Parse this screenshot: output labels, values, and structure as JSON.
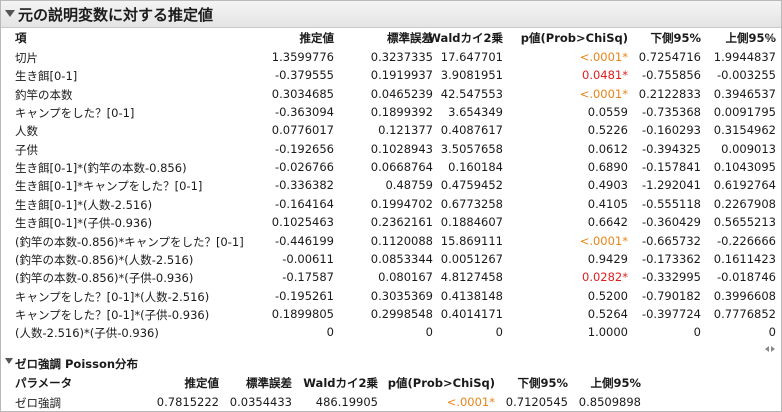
{
  "title": "元の説明変数に対する推定値",
  "table1": {
    "headers": [
      "項",
      "推定値",
      "標準誤差",
      "Waldカイ2乗",
      "p値(Prob>ChiSq)",
      "下側95%",
      "上側95%"
    ],
    "rows": [
      {
        "term": "切片",
        "est": "1.3599776",
        "se": "0.3237335",
        "wald": "17.647701",
        "p": "<.0001*",
        "p_color": "orange",
        "lo": "0.7254716",
        "hi": "1.9944837"
      },
      {
        "term": "生き餌[0-1]",
        "est": "-0.379555",
        "se": "0.1919937",
        "wald": "3.9081951",
        "p": "0.0481*",
        "p_color": "red",
        "lo": "-0.755856",
        "hi": "-0.003255"
      },
      {
        "term": "釣竿の本数",
        "est": "0.3034685",
        "se": "0.0465239",
        "wald": "42.547553",
        "p": "<.0001*",
        "p_color": "orange",
        "lo": "0.2122833",
        "hi": "0.3946537"
      },
      {
        "term": "キャンプをした？[0-1]",
        "est": "-0.363094",
        "se": "0.1899392",
        "wald": "3.654349",
        "p": "0.0559",
        "p_color": "",
        "lo": "-0.735368",
        "hi": "0.0091795"
      },
      {
        "term": "人数",
        "est": "0.0776017",
        "se": "0.121377",
        "wald": "0.4087617",
        "p": "0.5226",
        "p_color": "",
        "lo": "-0.160293",
        "hi": "0.3154962"
      },
      {
        "term": "子供",
        "est": "-0.192656",
        "se": "0.1028943",
        "wald": "3.5057658",
        "p": "0.0612",
        "p_color": "",
        "lo": "-0.394325",
        "hi": "0.009013"
      },
      {
        "term": "生き餌[0-1]*(釣竿の本数-0.856)",
        "est": "-0.026766",
        "se": "0.0668764",
        "wald": "0.160184",
        "p": "0.6890",
        "p_color": "",
        "lo": "-0.157841",
        "hi": "0.1043095"
      },
      {
        "term": "生き餌[0-1]*キャンプをした？[0-1]",
        "est": "-0.336382",
        "se": "0.48759",
        "wald": "0.4759452",
        "p": "0.4903",
        "p_color": "",
        "lo": "-1.292041",
        "hi": "0.6192764"
      },
      {
        "term": "生き餌[0-1]*(人数-2.516)",
        "est": "-0.164164",
        "se": "0.1994702",
        "wald": "0.6773258",
        "p": "0.4105",
        "p_color": "",
        "lo": "-0.555118",
        "hi": "0.2267908"
      },
      {
        "term": "生き餌[0-1]*(子供-0.936)",
        "est": "0.1025463",
        "se": "0.2362161",
        "wald": "0.1884607",
        "p": "0.6642",
        "p_color": "",
        "lo": "-0.360429",
        "hi": "0.5655213"
      },
      {
        "term": "(釣竿の本数-0.856)*キャンプをした？[0-1]",
        "est": "-0.446199",
        "se": "0.1120088",
        "wald": "15.869111",
        "p": "<.0001*",
        "p_color": "orange",
        "lo": "-0.665732",
        "hi": "-0.226666"
      },
      {
        "term": "(釣竿の本数-0.856)*(人数-2.516)",
        "est": "-0.00611",
        "se": "0.0853344",
        "wald": "0.0051267",
        "p": "0.9429",
        "p_color": "",
        "lo": "-0.173362",
        "hi": "0.1611423"
      },
      {
        "term": "(釣竿の本数-0.856)*(子供-0.936)",
        "est": "-0.17587",
        "se": "0.080167",
        "wald": "4.8127458",
        "p": "0.0282*",
        "p_color": "red",
        "lo": "-0.332995",
        "hi": "-0.018746"
      },
      {
        "term": "キャンプをした？[0-1]*(人数-2.516)",
        "est": "-0.195261",
        "se": "0.3035369",
        "wald": "0.4138148",
        "p": "0.5200",
        "p_color": "",
        "lo": "-0.790182",
        "hi": "0.3996608"
      },
      {
        "term": "キャンプをした？[0-1]*(子供-0.936)",
        "est": "0.1899805",
        "se": "0.2998548",
        "wald": "0.4014171",
        "p": "0.5264",
        "p_color": "",
        "lo": "-0.397724",
        "hi": "0.7776852"
      },
      {
        "term": "(人数-2.516)*(子供-0.936)",
        "est": "0",
        "se": "0",
        "wald": "0",
        "p": "1.0000",
        "p_color": "",
        "lo": "0",
        "hi": "0"
      }
    ]
  },
  "section2": {
    "title": "ゼロ強調 Poisson分布",
    "headers": [
      "パラメータ",
      "推定値",
      "標準誤差",
      "Waldカイ2乗",
      "p値(Prob>ChiSq)",
      "下側95%",
      "上側95%"
    ],
    "row": {
      "term": "ゼロ強調",
      "est": "0.7815222",
      "se": "0.0354433",
      "wald": "486.19905",
      "p": "<.0001*",
      "p_color": "orange",
      "lo": "0.7120545",
      "hi": "0.8509898"
    }
  },
  "icons": {
    "disclosure": "disclosure-triangle-icon",
    "scroll": "column-scroll-icon"
  },
  "colors": {
    "significant_orange": "#e8841a",
    "significant_red": "#e01e1e"
  }
}
